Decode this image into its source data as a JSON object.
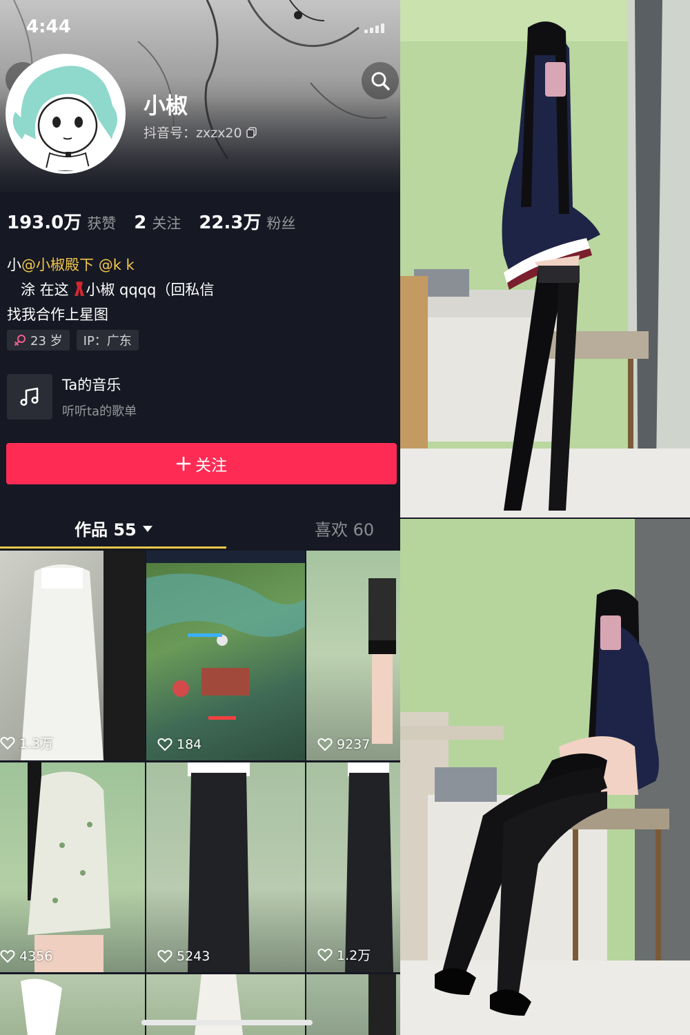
{
  "status_bar": {
    "time": "4:44"
  },
  "profile": {
    "nickname": "小椒",
    "douyin_id": "抖音号：zxzx20",
    "stats": [
      {
        "value": "193.0万",
        "label": "获赞"
      },
      {
        "value": "2",
        "label": "关注"
      },
      {
        "value": "22.3万",
        "label": "粉丝"
      }
    ],
    "bio": {
      "line1_prefix": "小",
      "line1_mention1": "@小椒殿下",
      "line1_mention2": "@k k",
      "line2": "涂 在这",
      "line2_rest": "小椒 qqqq（回私信",
      "line3": "找我合作上星图"
    },
    "tags": [
      {
        "icon": "female-icon",
        "text": "23 岁"
      },
      {
        "text": "IP：广东"
      }
    ],
    "music": {
      "title": "Ta的音乐",
      "subtitle": "听听ta的歌单"
    },
    "follow_button": {
      "label": "关注"
    },
    "tabs": {
      "works": "作品 55",
      "likes": "喜欢 60"
    }
  },
  "videos": [
    {
      "likes": "1.3万"
    },
    {
      "likes": "184"
    },
    {
      "likes": "9237"
    },
    {
      "likes": "4356"
    },
    {
      "likes": "5243"
    },
    {
      "likes": "1.2万"
    }
  ],
  "colors": {
    "background": "#161823",
    "accent_follow": "#fe2c55",
    "mention": "#f2c84b"
  }
}
